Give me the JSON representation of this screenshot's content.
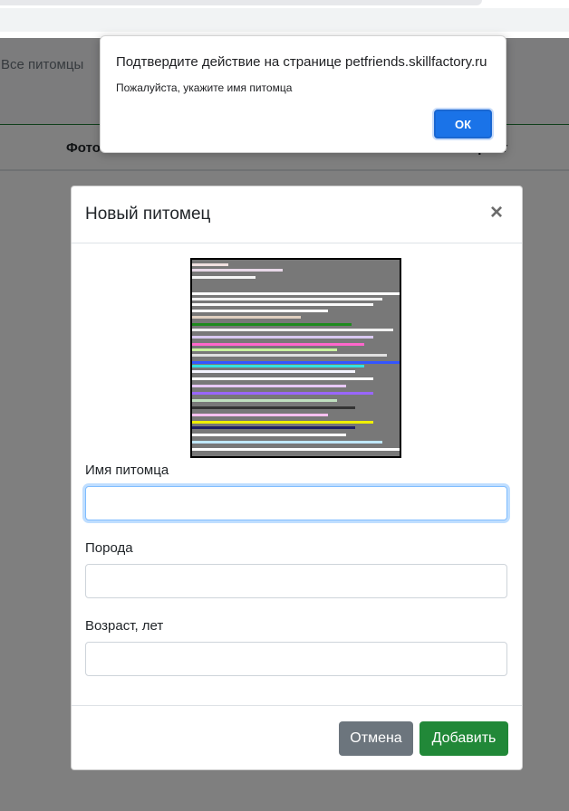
{
  "page": {
    "nav_link": "Все питомцы",
    "table_headers": [
      "Фото",
      "Возраст"
    ]
  },
  "modal": {
    "title": "Новый питомец",
    "close_glyph": "×",
    "fields": [
      {
        "label": "Имя питомца",
        "value": "",
        "placeholder": ""
      },
      {
        "label": "Порода",
        "value": "",
        "placeholder": ""
      },
      {
        "label": "Возраст, лет",
        "value": "",
        "placeholder": ""
      }
    ],
    "buttons": {
      "cancel": "Отмена",
      "add": "Добавить"
    }
  },
  "alert": {
    "title": "Подтвердите действие на странице petfriends.skillfactory.ru",
    "message": "Пожалуйста, укажите имя питомца",
    "ok": "ОК"
  },
  "colors": {
    "add_button": "#218838",
    "cancel_button": "#6c757d",
    "ok_button": "#1a73e8"
  }
}
